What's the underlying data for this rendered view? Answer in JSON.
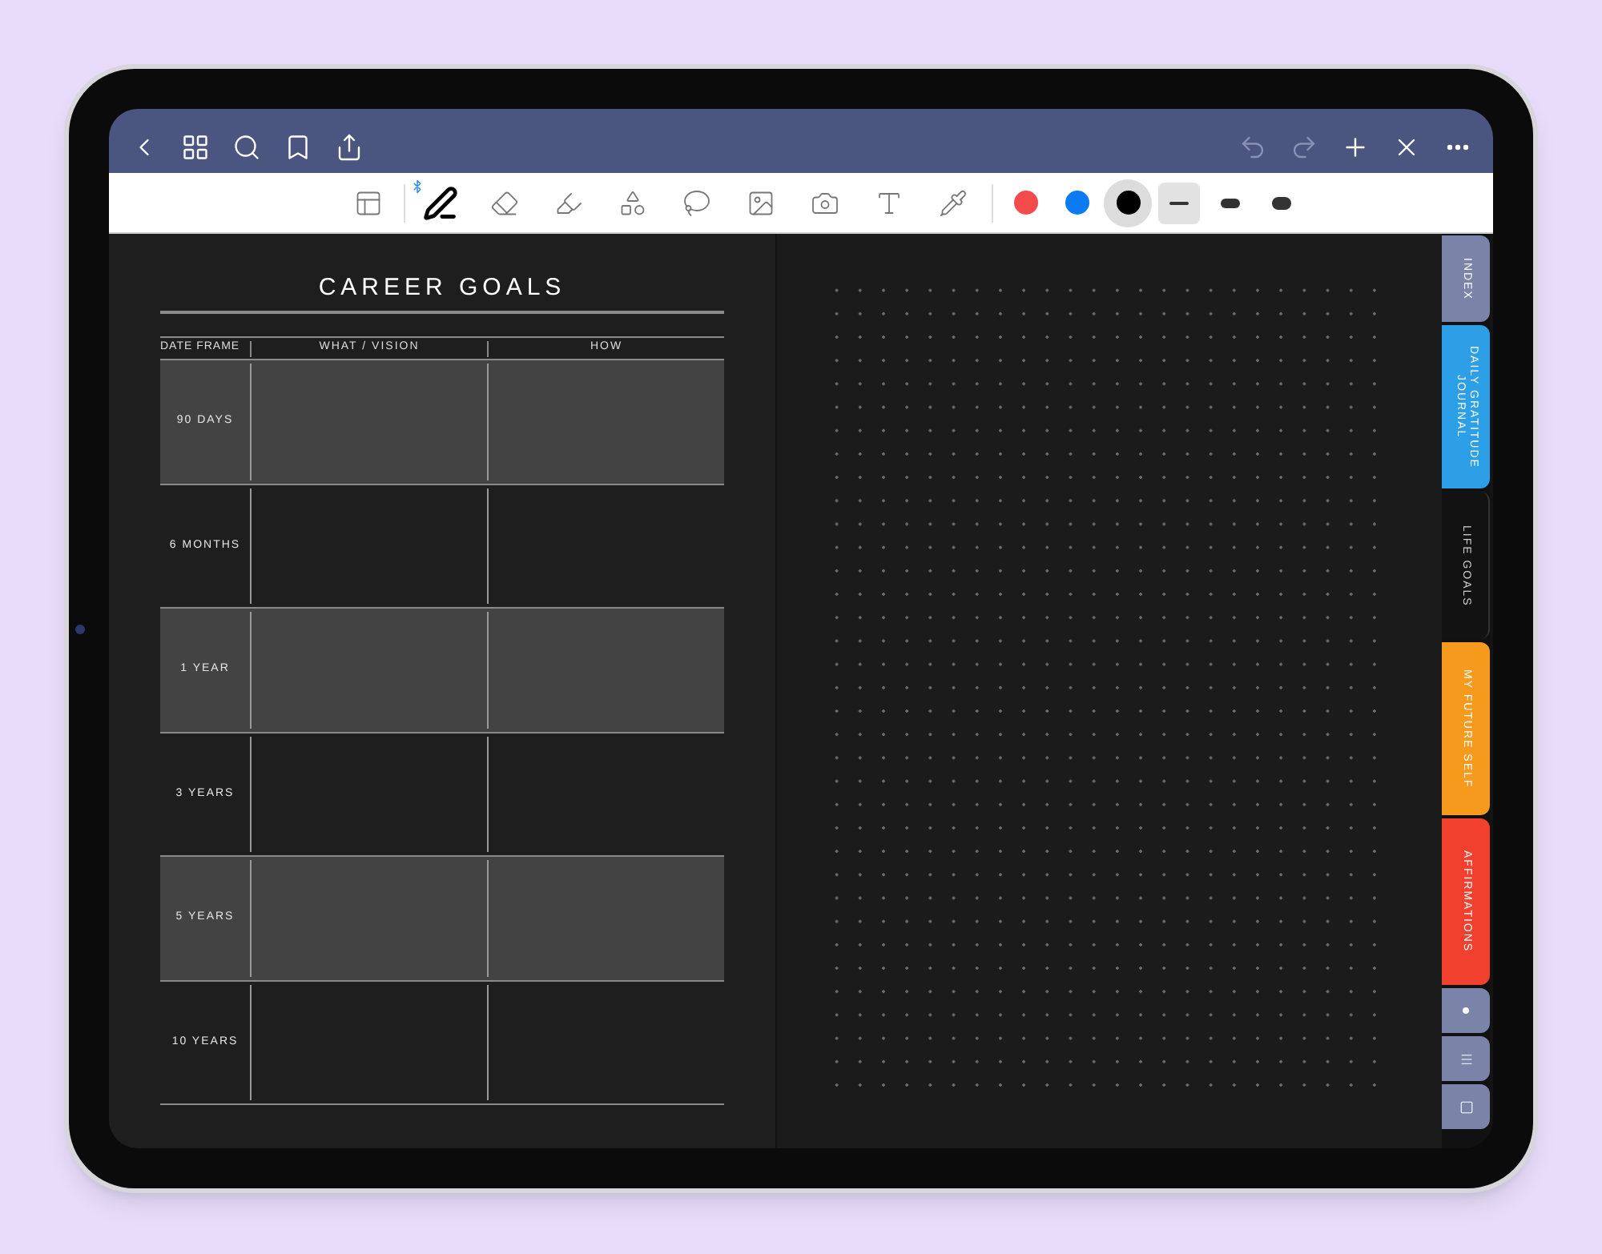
{
  "nav_bar": {
    "left": [
      {
        "kind": "back",
        "disabled": false
      },
      {
        "kind": "grid",
        "disabled": false
      },
      {
        "kind": "search",
        "disabled": false
      },
      {
        "kind": "bookmark",
        "disabled": false
      },
      {
        "kind": "share",
        "disabled": false
      }
    ],
    "right": [
      {
        "kind": "undo",
        "disabled": true
      },
      {
        "kind": "redo",
        "disabled": true
      },
      {
        "kind": "add",
        "disabled": false
      },
      {
        "kind": "close",
        "disabled": false
      },
      {
        "kind": "more",
        "disabled": false
      }
    ]
  },
  "toolbar": {
    "tools": [
      {
        "kind": "layout",
        "selected": false
      },
      {
        "kind": "pen",
        "selected": true
      },
      {
        "kind": "eraser",
        "selected": false
      },
      {
        "kind": "highlighter",
        "selected": false
      },
      {
        "kind": "shapes",
        "selected": false
      },
      {
        "kind": "lasso",
        "selected": false
      },
      {
        "kind": "image",
        "selected": false
      },
      {
        "kind": "camera",
        "selected": false
      },
      {
        "kind": "text",
        "selected": false
      },
      {
        "kind": "laser",
        "selected": false
      }
    ],
    "colors": [
      {
        "color": "#f24b4b",
        "selected": false
      },
      {
        "color": "#0a7bf0",
        "selected": false
      },
      {
        "color": "#000000",
        "selected": true
      }
    ],
    "strokes": [
      {
        "kind": "thin",
        "selected": true
      },
      {
        "kind": "medium",
        "selected": false
      },
      {
        "kind": "thick",
        "selected": false
      }
    ]
  },
  "page": {
    "title": "CAREER GOALS",
    "columns": [
      "DATE FRAME",
      "WHAT / VISION",
      "HOW"
    ],
    "rows": [
      {
        "label": "90 DAYS",
        "shaded": true
      },
      {
        "label": "6 MONTHS",
        "shaded": false
      },
      {
        "label": "1 YEAR",
        "shaded": true
      },
      {
        "label": "3 YEARS",
        "shaded": false
      },
      {
        "label": "5 YEARS",
        "shaded": true
      },
      {
        "label": "10 YEARS",
        "shaded": false
      }
    ]
  },
  "side_tabs": [
    {
      "kind": "text",
      "label": "INDEX",
      "color": "#7a83a8",
      "selected": false
    },
    {
      "kind": "text",
      "label": "DAILY GRATITUDE JOURNAL",
      "color": "#2d9fe6",
      "selected": false
    },
    {
      "kind": "text",
      "label": "LIFE GOALS",
      "color": "#121212",
      "selected": true
    },
    {
      "kind": "text",
      "label": "MY FUTURE SELF",
      "color": "#f59a1d",
      "selected": false
    },
    {
      "kind": "text",
      "label": "AFFIRMATIONS",
      "color": "#f2402e",
      "selected": false
    },
    {
      "kind": "dot",
      "color": "#7a83a8",
      "selected": false
    },
    {
      "kind": "lines",
      "color": "#7a83a8",
      "selected": false
    },
    {
      "kind": "square",
      "color": "#7a83a8",
      "selected": false
    }
  ]
}
